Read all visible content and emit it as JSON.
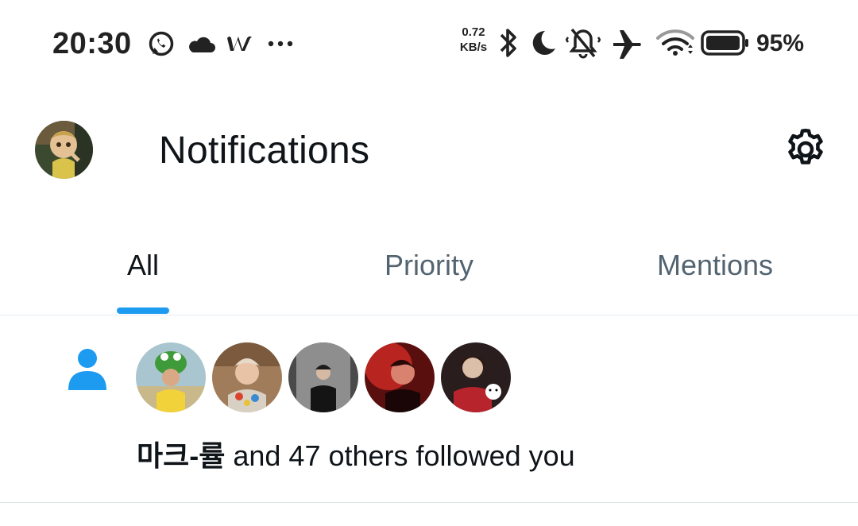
{
  "status_bar": {
    "time": "20:30",
    "net_speed_value": "0.72",
    "net_speed_unit": "KB/s",
    "battery_percent": "95%",
    "icons": [
      "whatsapp-icon",
      "cloud-icon",
      "w-app-icon",
      "more-dots-icon",
      "bluetooth-icon",
      "moon-icon",
      "bell-muted-icon",
      "airplane-icon",
      "wifi-icon",
      "battery-icon"
    ]
  },
  "header": {
    "title": "Notifications",
    "settings_icon": "gear-icon"
  },
  "tabs": [
    {
      "label": "All",
      "active": true
    },
    {
      "label": "Priority",
      "active": false
    },
    {
      "label": "Mentions",
      "active": false
    }
  ],
  "notifications": [
    {
      "type_icon": "person-icon",
      "actor": "마크-률",
      "text": " and 47 others followed you",
      "avatars_shown": 5
    }
  ],
  "colors": {
    "accent": "#1d9bf0",
    "text_primary": "#0f1419",
    "text_secondary": "#536471"
  }
}
